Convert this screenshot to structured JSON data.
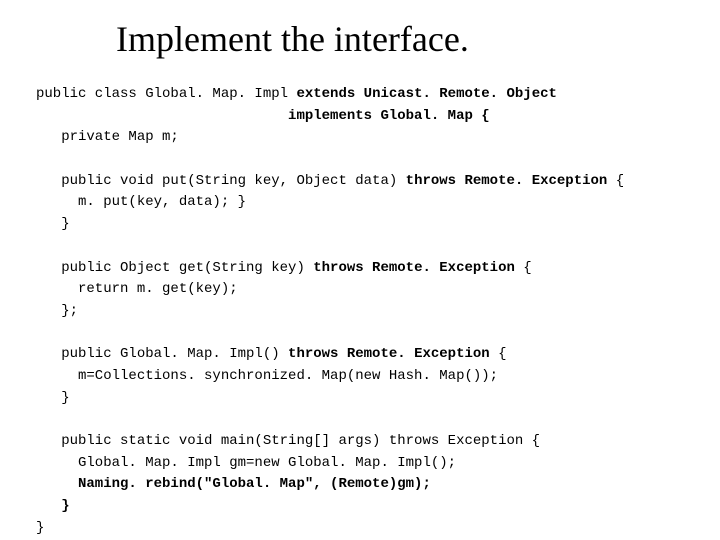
{
  "title": "Implement the interface.",
  "code": {
    "line1a": "public class Global. Map. Impl ",
    "line1b": "extends Unicast. Remote. Object",
    "line2": "                              implements Global. Map {",
    "line3": "   private Map m;",
    "line5a": "   public void put(String key, Object data)",
    "line5b": " throws Remote. Exception",
    "line5c": " {",
    "line6": "     m. put(key, data); }",
    "line7": "   }",
    "line9a": "   public Object get(String key) ",
    "line9b": "throws Remote. Exception",
    "line9c": " {",
    "line10": "     return m. get(key);",
    "line11": "   };",
    "line13a": "   public Global. Map. Impl() ",
    "line13b": "throws Remote. Exception",
    "line13c": " {",
    "line14": "     m=Collections. synchronized. Map(new Hash. Map());",
    "line15": "   }",
    "line17": "   public static void main(String[] args) throws Exception {",
    "line18": "     Global. Map. Impl gm=new Global. Map. Impl();",
    "line19": "     Naming. rebind(\"Global. Map\", (Remote)gm);",
    "line20": "   }",
    "line21": "}"
  }
}
